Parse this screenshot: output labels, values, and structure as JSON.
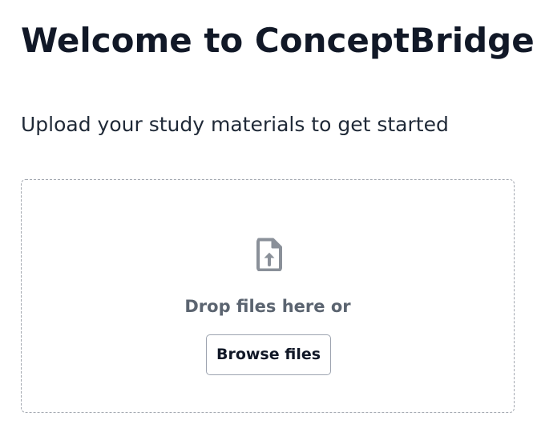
{
  "header": {
    "title": "Welcome to ConceptBridge",
    "subtitle": "Upload your study materials to get started"
  },
  "upload": {
    "icon": "file-upload-icon",
    "drop_text": "Drop files here or",
    "browse_label": "Browse files"
  },
  "colors": {
    "text_primary": "#111827",
    "text_muted": "#5b6470",
    "border": "#a3a8b0",
    "icon": "#8a9099"
  }
}
